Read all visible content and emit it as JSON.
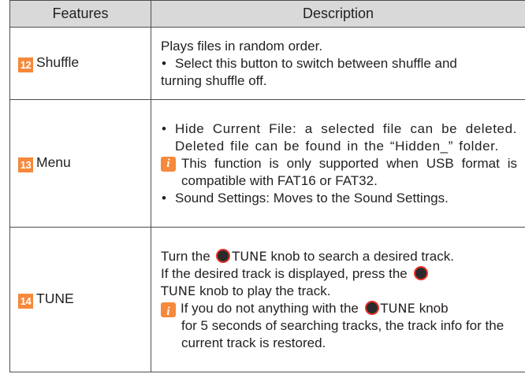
{
  "table": {
    "header": {
      "features": "Features",
      "description": "Description"
    },
    "rows": [
      {
        "number": "12",
        "feature": "Shuffle",
        "lines": {
          "l1": "Plays files in random order.",
          "b1a": "Select this button to switch between shuffle and",
          "b1b": "turning shuffle off."
        }
      },
      {
        "number": "13",
        "feature": "Menu",
        "lines": {
          "b1": "Hide Current File: a selected file can be deleted. Deleted file can be found in the “Hidden_” folder.",
          "note": "This function is only supported when USB format is compatible with FAT16 or FAT32.",
          "b2": "Sound Settings: Moves to the Sound Settings."
        }
      },
      {
        "number": "14",
        "feature": "TUNE",
        "lines": {
          "l1a": "Turn the",
          "tune": "TUNE",
          "l1b": "knob to search a desired track.",
          "l2": "If the desired track is displayed, press the",
          "l3b": "knob to play the track.",
          "note_a": "If you do not anything with the",
          "note_b": "knob",
          "note_c": "for 5 seconds of searching tracks, the track info for the current track is restored."
        }
      }
    ]
  },
  "icons": {
    "note": "info-note-icon",
    "knob": "tune-knob-icon",
    "note_glyph": "i"
  },
  "colors": {
    "accent": "#f5893c",
    "header_bg": "#d9d9d9",
    "knob_ring": "#e8332a"
  }
}
